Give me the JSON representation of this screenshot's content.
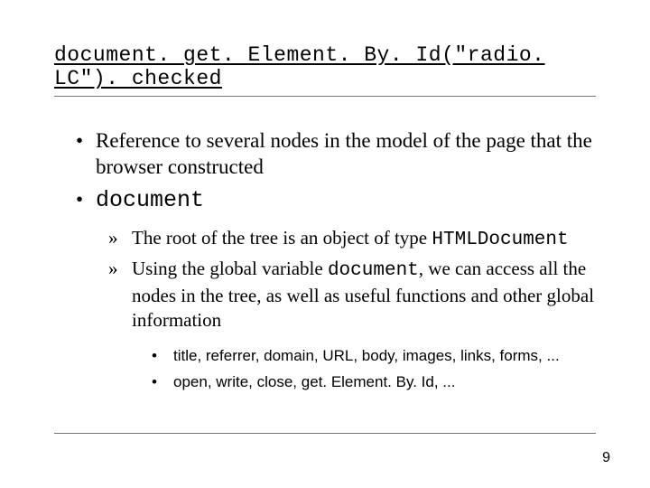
{
  "title": "document. get. Element. By. Id(\"radio. LC\"). checked",
  "bullets": {
    "l1a": "Reference to several nodes in the model of the page that the browser constructed",
    "l1b": "document",
    "l2a_pre": "The root of the tree is an object of type ",
    "l2a_code": "HTMLDocument",
    "l2b_pre": "Using the global variable ",
    "l2b_code": "document",
    "l2b_post": ", we can access all the nodes in the tree, as well as useful functions and other global information",
    "l3a": "title, referrer, domain, URL, body, images, links, forms, ...",
    "l3b": "open, write, close, get. Element. By. Id, ..."
  },
  "marks": {
    "l1": "•",
    "l2": "»",
    "l3": "•"
  },
  "page_number": "9"
}
